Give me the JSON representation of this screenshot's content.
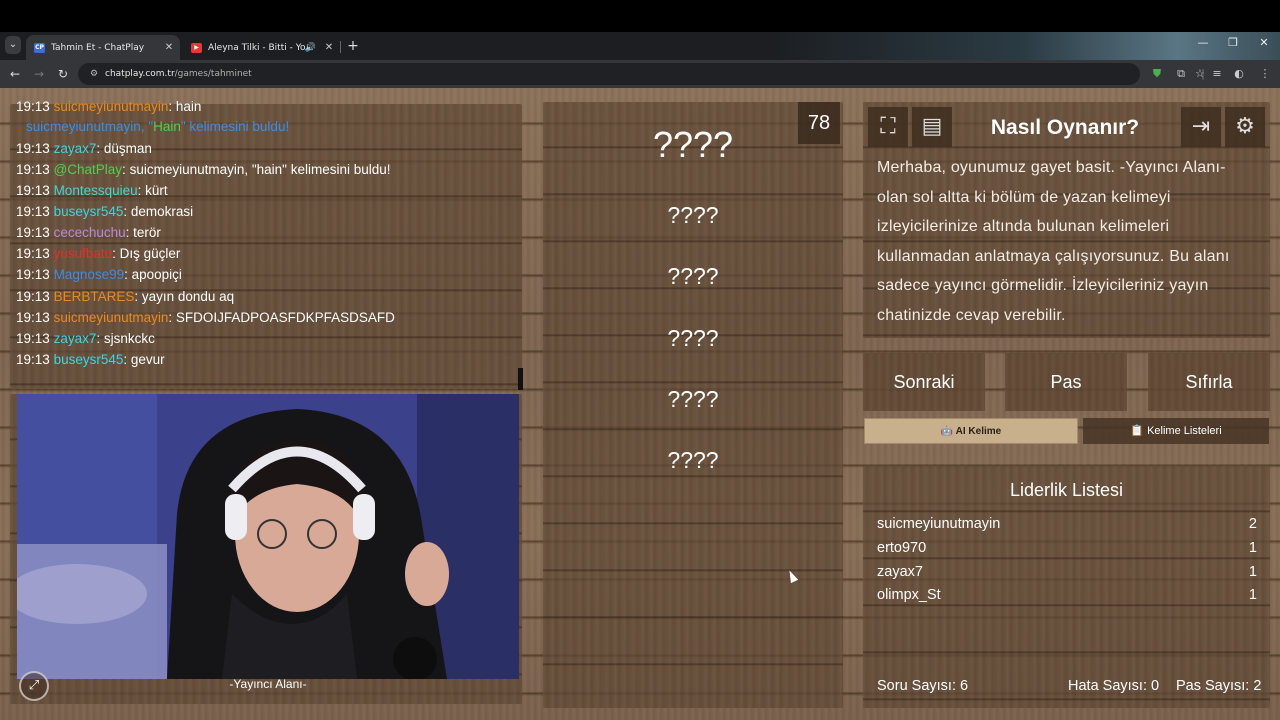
{
  "browser": {
    "tabs": [
      {
        "title": "Tahmin Et - ChatPlay",
        "favicon": "CP"
      },
      {
        "title": "Aleyna Tilki - Bitti - YouTube",
        "favicon": "YT"
      }
    ],
    "url_host": "chatplay.com.tr",
    "url_path": "/games/tahminet"
  },
  "chat": {
    "messages": [
      {
        "time": "19:13",
        "user": "suicmeyiunutmayin",
        "sep": ": ",
        "text": "hain",
        "color": "#e88a22"
      },
      {
        "time": "",
        "user": "",
        "sep": "",
        "text": "",
        "system": true
      },
      {
        "time": "19:13",
        "user": "zayax7",
        "sep": ": ",
        "text": "düşman",
        "color": "#3ad7e3"
      },
      {
        "time": "19:13",
        "user": "@ChatPlay",
        "sep": ": ",
        "text": "suicmeyiunutmayin, \"hain\" kelimesini buldu!",
        "color": "#4cd24c"
      },
      {
        "time": "19:13",
        "user": "Montessquieu",
        "sep": ": ",
        "text": "kürt",
        "color": "#42d6d2"
      },
      {
        "time": "19:13",
        "user": "buseysr545",
        "sep": ": ",
        "text": "demokrasi",
        "color": "#3ad7e3"
      },
      {
        "time": "19:13",
        "user": "cecechuchu",
        "sep": ": ",
        "text": "terör",
        "color": "#b98ad8"
      },
      {
        "time": "19:13",
        "user": "yusufbatu",
        "sep": ": ",
        "text": "Dış güçler",
        "color": "#e0322a"
      },
      {
        "time": "19:13",
        "user": "Magnose99",
        "sep": ": ",
        "text": "apoopiçi",
        "color": "#3d8de6"
      },
      {
        "time": "19:13",
        "user": "BERBTARES",
        "sep": ": ",
        "text": "yayın dondu aq",
        "color": "#e88a22"
      },
      {
        "time": "19:13",
        "user": "suicmeyiunutmayin",
        "sep": ": ",
        "text": "SFDOIJFADPOASFDKPFASDSAFD",
        "color": "#e88a22"
      },
      {
        "time": "19:13",
        "user": "zayax7",
        "sep": ": ",
        "text": "sjsnkckc",
        "color": "#3ad7e3"
      },
      {
        "time": "19:13",
        "user": "buseysr545",
        "sep": ": ",
        "text": "gevur",
        "color": "#3ad7e3"
      }
    ],
    "system_line": {
      "prefix": "suicmeyiunutmayin, \"",
      "word": "Hain",
      "suffix": "\" kelimesini buldu!"
    }
  },
  "streamer": {
    "label": "-Yayıncı Alanı-"
  },
  "game": {
    "timer": "78",
    "main_word": "????",
    "hidden_words": [
      "????",
      "????",
      "????",
      "????",
      "????"
    ]
  },
  "howto": {
    "title": "Nasıl Oynanır?",
    "text": "Merhaba, oyunumuz gayet basit. -Yayıncı Alanı- olan sol altta ki bölüm de yazan kelimeyi izleyicilerinize altında bulunan kelimeleri kullanmadan anlatmaya çalışıyorsunuz. Bu alanı sadece yayıncı görmelidir. İzleyicileriniz yayın chatinizde cevap verebilir."
  },
  "controls": {
    "next": "Sonraki",
    "pass": "Pas",
    "reset": "Sıfırla",
    "ai_word": "AI Kelime",
    "word_lists": "Kelime Listeleri"
  },
  "leaderboard": {
    "title": "Liderlik Listesi",
    "rows": [
      {
        "name": "suicmeyiunutmayin",
        "score": "2"
      },
      {
        "name": "erto970",
        "score": "1"
      },
      {
        "name": "zayax7",
        "score": "1"
      },
      {
        "name": "olimpx_St",
        "score": "1"
      }
    ]
  },
  "stats": {
    "questions": "Soru Sayısı: 6",
    "errors": "Hata Sayısı: 0",
    "passes": "Pas Sayısı: 2"
  },
  "colors": {
    "name_orange": "#e88a22",
    "name_cyan": "#3ad7e3",
    "name_blue": "#3d8de6",
    "ai_button": "#c9b08d"
  }
}
